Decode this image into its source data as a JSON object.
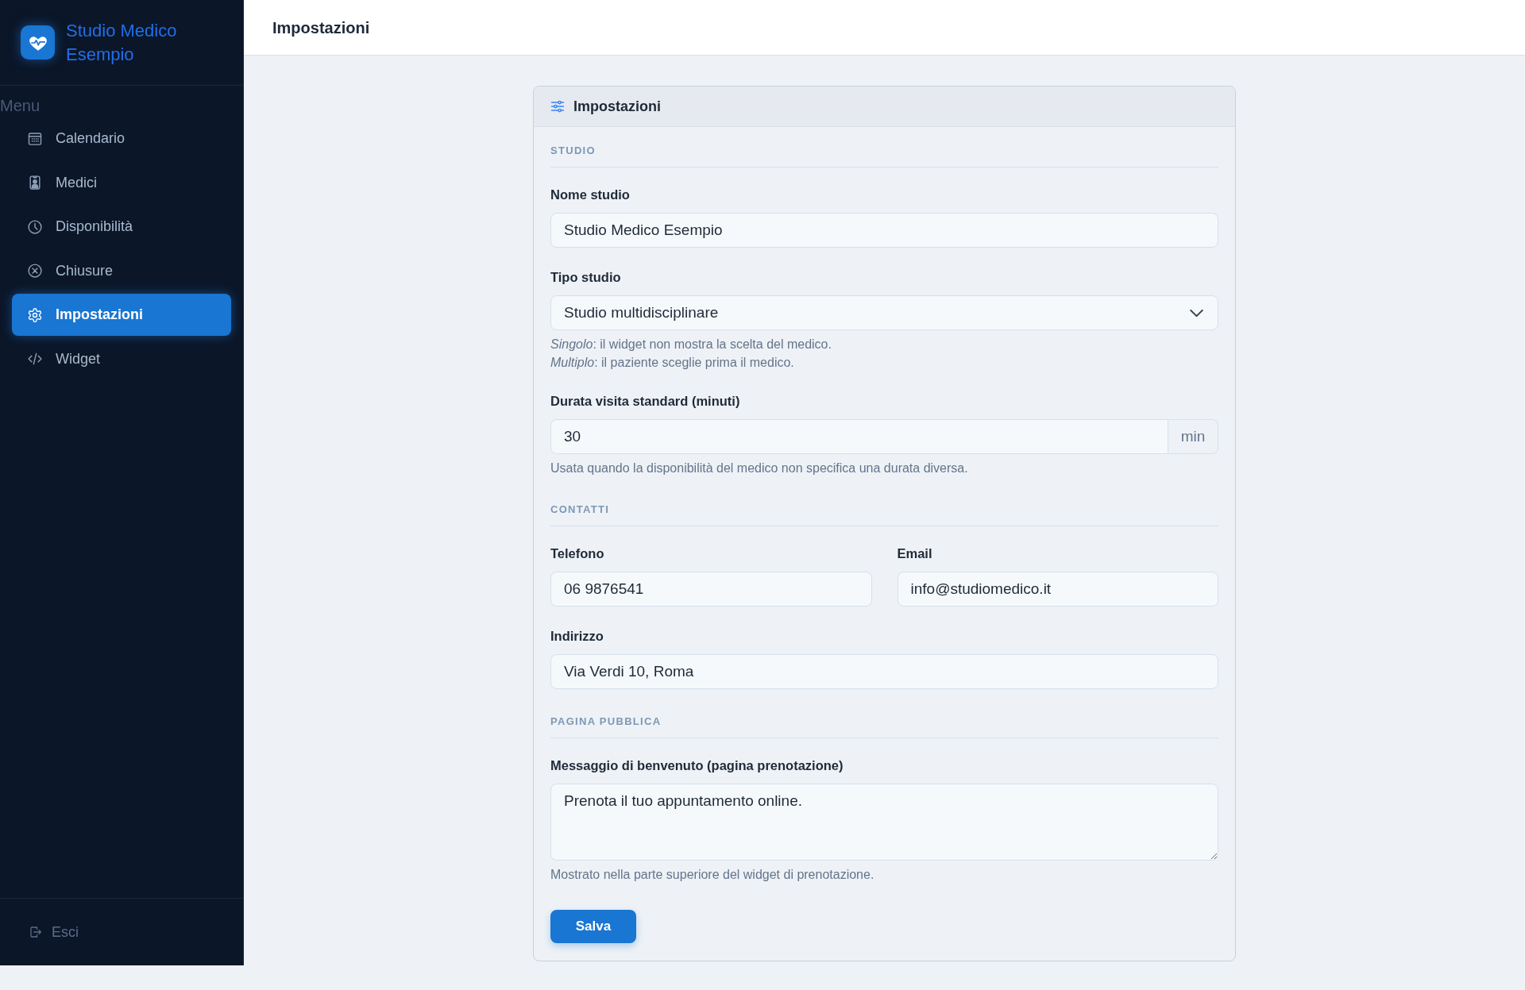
{
  "sidebar": {
    "brand": "Studio Medico Esempio",
    "menu_label": "Menu",
    "items": [
      {
        "label": "Calendario",
        "selected": false
      },
      {
        "label": "Medici",
        "selected": false
      },
      {
        "label": "Disponibilità",
        "selected": false
      },
      {
        "label": "Chiusure",
        "selected": false
      },
      {
        "label": "Impostazioni",
        "selected": true
      },
      {
        "label": "Widget",
        "selected": false
      }
    ],
    "logout": "Esci"
  },
  "header": {
    "title": "Impostazioni"
  },
  "settings_card": {
    "title": "Impostazioni",
    "sections": [
      {
        "title": "STUDIO",
        "rows": [
          {
            "fields": [
              {
                "kind": "text",
                "label": "Nome studio",
                "value": "Studio Medico Esempio"
              }
            ]
          },
          {
            "fields": [
              {
                "kind": "select",
                "label": "Tipo studio",
                "value": "Studio multidisciplinare",
                "help": [
                  "*Singolo*: il widget non mostra la scelta del medico.",
                  "*Multiplo*: il paziente sceglie prima il medico."
                ]
              }
            ]
          },
          {
            "fields": [
              {
                "kind": "number",
                "label": "Durata visita standard (minuti)",
                "value": "30",
                "unit": "min",
                "help": [
                  "Usata quando la disponibilità del medico non specifica una durata diversa."
                ]
              }
            ]
          }
        ]
      },
      {
        "title": "CONTATTI",
        "rows": [
          {
            "fields": [
              {
                "kind": "text",
                "label": "Telefono",
                "value": "06 9876541"
              },
              {
                "kind": "text",
                "label": "Email",
                "value": "info@studiomedico.it"
              }
            ]
          },
          {
            "fields": [
              {
                "kind": "text",
                "label": "Indirizzo",
                "value": "Via Verdi 10, Roma"
              }
            ]
          }
        ]
      },
      {
        "title": "PAGINA PUBBLICA",
        "rows": [
          {
            "fields": [
              {
                "kind": "textarea",
                "label": "Messaggio di benvenuto (pagina prenotazione)",
                "value": "Prenota il tuo appuntamento online.",
                "help": [
                  "Mostrato nella parte superiore del widget di prenotazione."
                ]
              }
            ]
          }
        ]
      }
    ],
    "save_button": "Salva"
  }
}
